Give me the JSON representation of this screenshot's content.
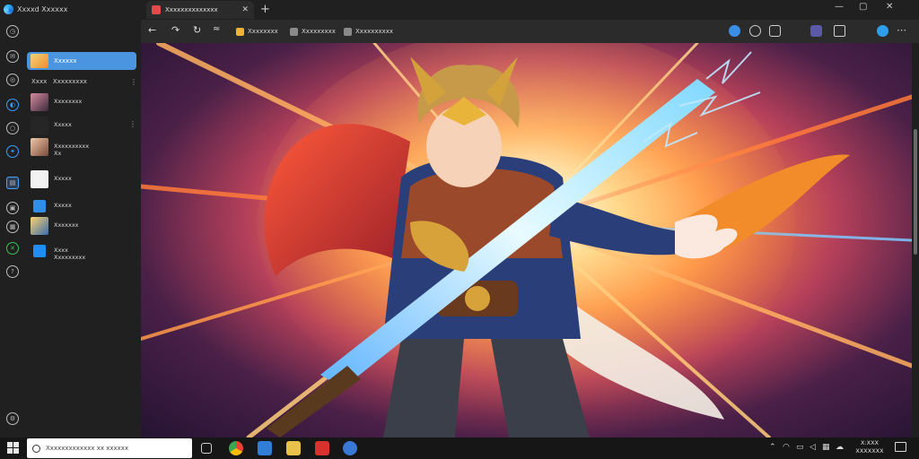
{
  "app": {
    "title": "Xxxxd Xxxxxx",
    "rail_icons": [
      "clock-icon",
      "chat-icon",
      "globe-icon",
      "edge-icon",
      "circle-icon",
      "pin-icon",
      "page-icon",
      "camera-icon",
      "store-icon",
      "xbox-icon",
      "help-icon",
      "settings-icon"
    ],
    "selected_item": "Xxxxxx",
    "section": {
      "label": "Xxxx",
      "sub": "Xxxxxxxxx"
    },
    "items": [
      {
        "line1": "Xxxxxxxx",
        "line2": ""
      },
      {
        "line1": "Xxxxx",
        "line2": ""
      },
      {
        "line1": "Xxxxxxxxxx",
        "line2": "Xx"
      },
      {
        "line1": "Xxxxx",
        "line2": ""
      },
      {
        "line1": "Xxxxx",
        "line2": ""
      },
      {
        "line1": "Xxxxxxx",
        "line2": ""
      },
      {
        "line1": "Xxxx",
        "line2": "Xxxxxxxxx"
      }
    ]
  },
  "browser": {
    "tab_title": "Xxxxxxxxxxxxxx",
    "toolbar_favorites": [
      {
        "label": "Xxxxxxxx",
        "color": "#f2b233"
      },
      {
        "label": "Xxxxxxxxx",
        "color": "#8a8a8a"
      },
      {
        "label": "Xxxxxxxxxx",
        "color": "#8a8a8a"
      }
    ]
  },
  "taskbar": {
    "search_placeholder": "Xxxxxxxxxxxxx xx xxxxxx",
    "clock_time": "X:XXX",
    "clock_date": "XXXXXXX"
  },
  "colors": {
    "accent": "#4b95e0",
    "artwork_glow": "#ffd07a",
    "sword": "#7fd8ff"
  }
}
